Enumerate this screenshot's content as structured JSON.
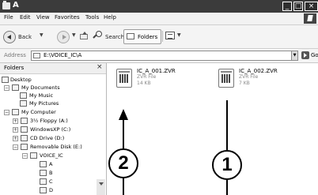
{
  "window": {
    "title": "A"
  },
  "menu": [
    "File",
    "Edit",
    "View",
    "Favorites",
    "Tools",
    "Help"
  ],
  "toolbar": {
    "back_label": "Back",
    "search_label": "Search",
    "folders_label": "Folders"
  },
  "address": {
    "label": "Address",
    "path": "E:\\VOICE_IC\\A",
    "go_label": "Go"
  },
  "folders_pane": {
    "title": "Folders",
    "items": [
      "Desktop",
      "My Documents",
      "My Music",
      "My Pictures",
      "My Computer",
      "3½ Floppy (A:)",
      "WindowsXP (C:)",
      "CD Drive (D:)",
      "Removable Disk (E:)",
      "VOICE_IC",
      "A",
      "B",
      "C",
      "D"
    ]
  },
  "files": [
    {
      "name": "IC_A_001.ZVR",
      "type": "ZVR File",
      "size": "14 KB"
    },
    {
      "name": "IC_A_002.ZVR",
      "type": "ZVR File",
      "size": "7 KB"
    }
  ],
  "callouts": {
    "one": "1",
    "two": "2"
  }
}
